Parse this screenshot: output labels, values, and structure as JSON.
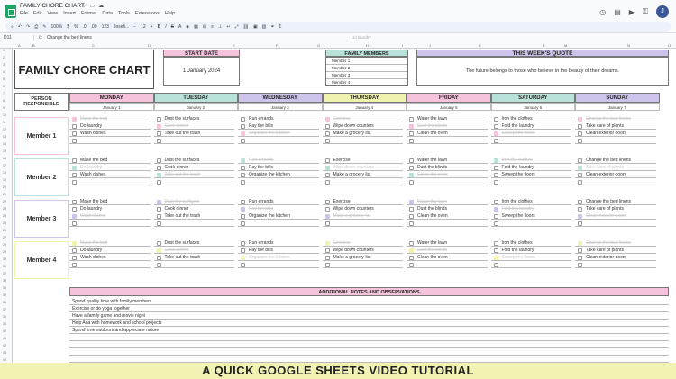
{
  "app": {
    "doc_title": "FAMILY CHORE CHART",
    "menus": [
      "File",
      "Edit",
      "View",
      "Insert",
      "Format",
      "Data",
      "Tools",
      "Extensions",
      "Help"
    ],
    "avatar": "J"
  },
  "toolbar": {
    "zoom": "100%",
    "currency": "$",
    "percent": "%",
    "dec1": ".0",
    "dec2": ".00",
    "fmt": "123",
    "font": "Josefi...",
    "size": "12",
    "bold": "B",
    "italic": "I",
    "strike": "S",
    "textcolor": "A"
  },
  "formula_bar": {
    "cell_ref": "D11",
    "fx": "fx",
    "content": "Change the bed linens"
  },
  "ghost": {
    "content": "Do laundry"
  },
  "columns": [
    "A",
    "B",
    "C",
    "D",
    "E",
    "F",
    "G",
    "H",
    "I",
    "J",
    "K",
    "L",
    "M",
    "N",
    "O"
  ],
  "rows": [
    "1",
    "2",
    "3",
    "4",
    "5",
    "6",
    "7",
    "8",
    "9",
    "10",
    "11",
    "12",
    "13",
    "14",
    "15",
    "16",
    "17",
    "18",
    "19",
    "20",
    "21",
    "22",
    "23",
    "24",
    "25",
    "26",
    "27",
    "28",
    "29",
    "30",
    "31",
    "32",
    "33",
    "34",
    "35",
    "36",
    "37",
    "38",
    "39",
    "40",
    "41",
    "42",
    "43",
    "44"
  ],
  "title": "FAMILY CHORE CHART",
  "start_date": {
    "label": "START DATE",
    "value": "1 January 2024"
  },
  "family": {
    "label": "FAMILY MEMBERS",
    "members": [
      "Member 1",
      "Member 2",
      "Member 3",
      "Member 4"
    ]
  },
  "quote": {
    "label": "THIS WEEK'S QUOTE",
    "text": "The future belongs to those who believe in the beauty of their dreams."
  },
  "person_label": "PERSON RESPONSIBLE",
  "days": [
    {
      "name": "MONDAY",
      "date": "January 1",
      "color": "#f6c3dd"
    },
    {
      "name": "TUESDAY",
      "date": "January 2",
      "color": "#b9e2da"
    },
    {
      "name": "WEDNESDAY",
      "date": "January 3",
      "color": "#cec3ea"
    },
    {
      "name": "THURSDAY",
      "date": "January 4",
      "color": "#f0f2b0"
    },
    {
      "name": "FRIDAY",
      "date": "January 5",
      "color": "#f6c3dd"
    },
    {
      "name": "SATURDAY",
      "date": "January 6",
      "color": "#b9e2da"
    },
    {
      "name": "SUNDAY",
      "date": "January 7",
      "color": "#cec3ea"
    }
  ],
  "member_colors": [
    "#f6c3dd",
    "#b9e2da",
    "#cec3ea",
    "#f0f2b0"
  ],
  "chores": [
    {
      "member": "Member 1",
      "days": [
        [
          {
            "t": "Make the bed",
            "d": true
          },
          {
            "t": "Do laundry",
            "d": false
          },
          {
            "t": "Wash dishes",
            "d": false
          },
          {
            "t": "",
            "d": false
          }
        ],
        [
          {
            "t": "Dust the surfaces",
            "d": false
          },
          {
            "t": "Cook dinner",
            "d": true
          },
          {
            "t": "Take out the trash",
            "d": false
          },
          {
            "t": "",
            "d": false
          }
        ],
        [
          {
            "t": "Run errands",
            "d": false
          },
          {
            "t": "Pay the bills",
            "d": false
          },
          {
            "t": "Organize the kitchen",
            "d": true
          },
          {
            "t": "",
            "d": false
          }
        ],
        [
          {
            "t": "Exercise",
            "d": true
          },
          {
            "t": "Wipe down counters",
            "d": false
          },
          {
            "t": "Make a grocery list",
            "d": false
          },
          {
            "t": "",
            "d": false
          }
        ],
        [
          {
            "t": "Water the lawn",
            "d": false
          },
          {
            "t": "Dust the blinds",
            "d": true
          },
          {
            "t": "Clean the oven",
            "d": false
          },
          {
            "t": "",
            "d": false
          }
        ],
        [
          {
            "t": "Iron the clothes",
            "d": false
          },
          {
            "t": "Fold the laundry",
            "d": false
          },
          {
            "t": "Sweep the floors",
            "d": true
          },
          {
            "t": "",
            "d": false
          }
        ],
        [
          {
            "t": "Change the bed linens",
            "d": true
          },
          {
            "t": "Take care of plants",
            "d": false
          },
          {
            "t": "Clean exterior doors",
            "d": false
          },
          {
            "t": "",
            "d": false
          }
        ]
      ]
    },
    {
      "member": "Member 2",
      "days": [
        [
          {
            "t": "Make the bed",
            "d": false
          },
          {
            "t": "Do laundry",
            "d": true
          },
          {
            "t": "Wash dishes",
            "d": false
          },
          {
            "t": "",
            "d": false
          }
        ],
        [
          {
            "t": "Dust the surfaces",
            "d": false
          },
          {
            "t": "Cook dinner",
            "d": false
          },
          {
            "t": "Take out the trash",
            "d": true
          },
          {
            "t": "",
            "d": false
          }
        ],
        [
          {
            "t": "Run errands",
            "d": true
          },
          {
            "t": "Pay the bills",
            "d": false
          },
          {
            "t": "Organize the kitchen",
            "d": false
          },
          {
            "t": "",
            "d": false
          }
        ],
        [
          {
            "t": "Exercise",
            "d": false
          },
          {
            "t": "Wipe down counters",
            "d": true
          },
          {
            "t": "Make a grocery list",
            "d": false
          },
          {
            "t": "",
            "d": false
          }
        ],
        [
          {
            "t": "Water the lawn",
            "d": false
          },
          {
            "t": "Dust the blinds",
            "d": false
          },
          {
            "t": "Clean the oven",
            "d": true
          },
          {
            "t": "",
            "d": false
          }
        ],
        [
          {
            "t": "Iron the clothes",
            "d": true
          },
          {
            "t": "Fold the laundry",
            "d": false
          },
          {
            "t": "Sweep the floors",
            "d": false
          },
          {
            "t": "",
            "d": false
          }
        ],
        [
          {
            "t": "Change the bed linens",
            "d": false
          },
          {
            "t": "Take care of plants",
            "d": true
          },
          {
            "t": "Clean exterior doors",
            "d": false
          },
          {
            "t": "",
            "d": false
          }
        ]
      ]
    },
    {
      "member": "Member 3",
      "days": [
        [
          {
            "t": "Make the bed",
            "d": false
          },
          {
            "t": "Do laundry",
            "d": false
          },
          {
            "t": "Wash dishes",
            "d": true
          },
          {
            "t": "",
            "d": false
          }
        ],
        [
          {
            "t": "Dust the surfaces",
            "d": true
          },
          {
            "t": "Cook dinner",
            "d": false
          },
          {
            "t": "Take out the trash",
            "d": false
          },
          {
            "t": "",
            "d": false
          }
        ],
        [
          {
            "t": "Run errands",
            "d": false
          },
          {
            "t": "Pay the bills",
            "d": true
          },
          {
            "t": "Organize the kitchen",
            "d": false
          },
          {
            "t": "",
            "d": false
          }
        ],
        [
          {
            "t": "Exercise",
            "d": false
          },
          {
            "t": "Wipe down counters",
            "d": false
          },
          {
            "t": "Make a grocery list",
            "d": true
          },
          {
            "t": "",
            "d": false
          }
        ],
        [
          {
            "t": "Water the lawn",
            "d": true
          },
          {
            "t": "Dust the blinds",
            "d": false
          },
          {
            "t": "Clean the oven",
            "d": false
          },
          {
            "t": "",
            "d": false
          }
        ],
        [
          {
            "t": "Iron the clothes",
            "d": false
          },
          {
            "t": "Fold the laundry",
            "d": true
          },
          {
            "t": "Sweep the floors",
            "d": false
          },
          {
            "t": "",
            "d": false
          }
        ],
        [
          {
            "t": "Change the bed linens",
            "d": false
          },
          {
            "t": "Take care of plants",
            "d": false
          },
          {
            "t": "Clean exterior doors",
            "d": true
          },
          {
            "t": "",
            "d": false
          }
        ]
      ]
    },
    {
      "member": "Member 4",
      "days": [
        [
          {
            "t": "Make the bed",
            "d": true
          },
          {
            "t": "Do laundry",
            "d": false
          },
          {
            "t": "Wash dishes",
            "d": false
          },
          {
            "t": "",
            "d": false
          }
        ],
        [
          {
            "t": "Dust the surfaces",
            "d": false
          },
          {
            "t": "Cook dinner",
            "d": true
          },
          {
            "t": "Take out the trash",
            "d": false
          },
          {
            "t": "",
            "d": false
          }
        ],
        [
          {
            "t": "Run errands",
            "d": false
          },
          {
            "t": "Pay the bills",
            "d": false
          },
          {
            "t": "Organize the kitchen",
            "d": true
          },
          {
            "t": "",
            "d": false
          }
        ],
        [
          {
            "t": "Exercise",
            "d": true
          },
          {
            "t": "Wipe down counters",
            "d": false
          },
          {
            "t": "Make a grocery list",
            "d": false
          },
          {
            "t": "",
            "d": false
          }
        ],
        [
          {
            "t": "Water the lawn",
            "d": false
          },
          {
            "t": "Dust the blinds",
            "d": true
          },
          {
            "t": "Clean the oven",
            "d": false
          },
          {
            "t": "",
            "d": false
          }
        ],
        [
          {
            "t": "Iron the clothes",
            "d": false
          },
          {
            "t": "Fold the laundry",
            "d": false
          },
          {
            "t": "Sweep the floors",
            "d": true
          },
          {
            "t": "",
            "d": false
          }
        ],
        [
          {
            "t": "Change the bed linens",
            "d": true
          },
          {
            "t": "Take care of plants",
            "d": false
          },
          {
            "t": "Clean exterior doors",
            "d": false
          },
          {
            "t": "",
            "d": false
          }
        ]
      ]
    }
  ],
  "notes": {
    "label": "ADDITIONAL NOTES AND OBSERVATIONS",
    "items": [
      "Spend quality time with family members",
      "Exercise or do yoga together",
      "Have a family game and movie night",
      "Help Ana with homework and school projects",
      "Spend time outdoors and appreciate nature",
      "",
      "",
      "",
      ""
    ]
  },
  "banner": "A QUICK GOOGLE SHEETS VIDEO TUTORIAL"
}
